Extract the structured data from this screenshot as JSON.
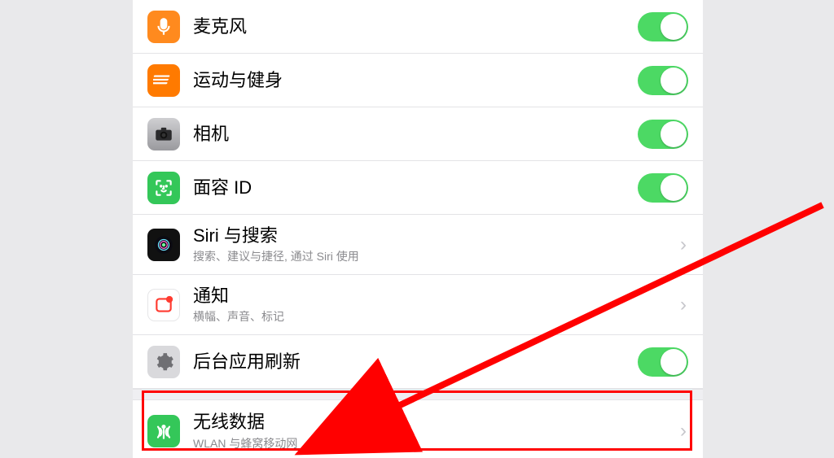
{
  "rows": [
    {
      "label": "麦克风",
      "sub": "",
      "control": "toggle",
      "icon": "mic-icon"
    },
    {
      "label": "运动与健身",
      "sub": "",
      "control": "toggle",
      "icon": "fitness-icon"
    },
    {
      "label": "相机",
      "sub": "",
      "control": "toggle",
      "icon": "camera-icon"
    },
    {
      "label": "面容 ID",
      "sub": "",
      "control": "toggle",
      "icon": "faceid-icon"
    },
    {
      "label": "Siri 与搜索",
      "sub": "搜索、建议与捷径, 通过 Siri 使用",
      "control": "chevron",
      "icon": "siri-icon"
    },
    {
      "label": "通知",
      "sub": "横幅、声音、标记",
      "control": "chevron",
      "icon": "notifications-icon"
    },
    {
      "label": "后台应用刷新",
      "sub": "",
      "control": "toggle",
      "icon": "gear-icon"
    },
    {
      "label": "无线数据",
      "sub": "WLAN 与蜂窝移动网",
      "control": "chevron",
      "icon": "wireless-icon"
    }
  ],
  "highlight_row_index": 7
}
